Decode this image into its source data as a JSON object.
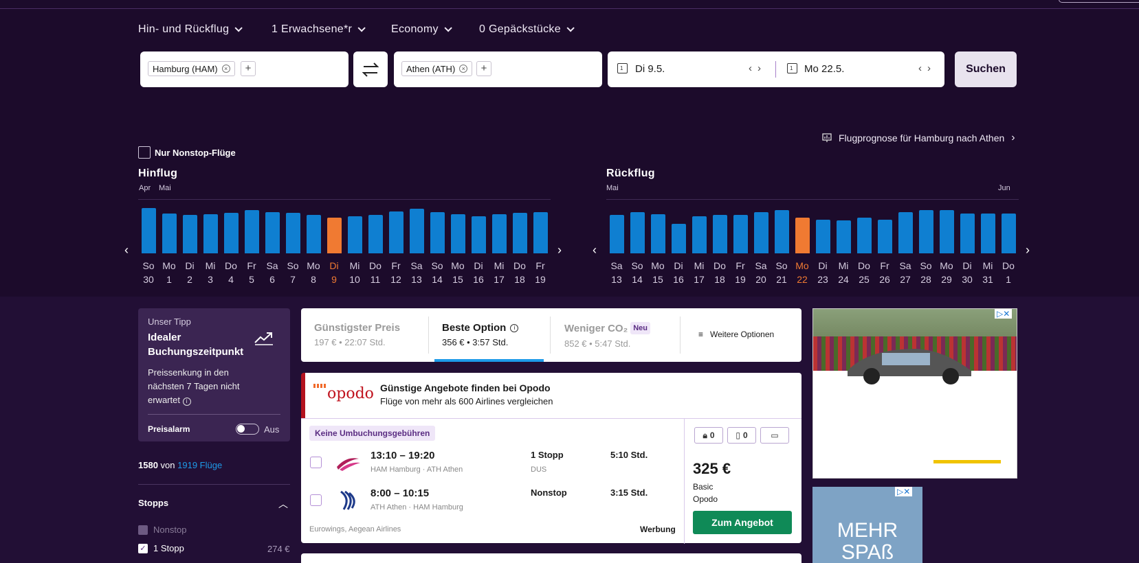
{
  "options": {
    "trip_type": "Hin- und Rückflug",
    "passengers": "1 Erwachsene*r",
    "cabin": "Economy",
    "baggage": "0 Gepäckstücke"
  },
  "search": {
    "origin": "Hamburg (HAM)",
    "destination": "Athen (ATH)",
    "depart_date": "Di 9.5.",
    "return_date": "Mo 22.5.",
    "search_label": "Suchen"
  },
  "forecast_link": "Flugprognose für Hamburg nach Athen",
  "nonstop_filter": "Nur Nonstop-Flüge",
  "outbound": {
    "title": "Hinflug",
    "months": [
      "Apr",
      "Mai"
    ],
    "days": [
      {
        "wd": "So",
        "d": "30",
        "level": 0.97
      },
      {
        "wd": "Mo",
        "d": "1",
        "level": 0.85
      },
      {
        "wd": "Di",
        "d": "2",
        "level": 0.82
      },
      {
        "wd": "Mi",
        "d": "3",
        "level": 0.84
      },
      {
        "wd": "Do",
        "d": "4",
        "level": 0.87
      },
      {
        "wd": "Fr",
        "d": "5",
        "level": 0.92
      },
      {
        "wd": "Sa",
        "d": "6",
        "level": 0.88
      },
      {
        "wd": "So",
        "d": "7",
        "level": 0.87
      },
      {
        "wd": "Mo",
        "d": "8",
        "level": 0.82
      },
      {
        "wd": "Di",
        "d": "9",
        "level": 0.77,
        "selected": true
      },
      {
        "wd": "Mi",
        "d": "10",
        "level": 0.8
      },
      {
        "wd": "Do",
        "d": "11",
        "level": 0.82
      },
      {
        "wd": "Fr",
        "d": "12",
        "level": 0.89
      },
      {
        "wd": "Sa",
        "d": "13",
        "level": 0.95
      },
      {
        "wd": "So",
        "d": "14",
        "level": 0.88
      },
      {
        "wd": "Mo",
        "d": "15",
        "level": 0.84
      },
      {
        "wd": "Di",
        "d": "16",
        "level": 0.8
      },
      {
        "wd": "Mi",
        "d": "17",
        "level": 0.84
      },
      {
        "wd": "Do",
        "d": "18",
        "level": 0.87
      },
      {
        "wd": "Fr",
        "d": "19",
        "level": 0.88
      }
    ]
  },
  "return": {
    "title": "Rückflug",
    "months": [
      "Mai",
      "Jun"
    ],
    "days": [
      {
        "wd": "Sa",
        "d": "13",
        "level": 0.82
      },
      {
        "wd": "So",
        "d": "14",
        "level": 0.88
      },
      {
        "wd": "Mo",
        "d": "15",
        "level": 0.84
      },
      {
        "wd": "Di",
        "d": "16",
        "level": 0.63
      },
      {
        "wd": "Mi",
        "d": "17",
        "level": 0.8
      },
      {
        "wd": "Do",
        "d": "18",
        "level": 0.82
      },
      {
        "wd": "Fr",
        "d": "19",
        "level": 0.83
      },
      {
        "wd": "Sa",
        "d": "20",
        "level": 0.88
      },
      {
        "wd": "So",
        "d": "21",
        "level": 0.92
      },
      {
        "wd": "Mo",
        "d": "22",
        "level": 0.77,
        "selected": true
      },
      {
        "wd": "Di",
        "d": "23",
        "level": 0.72
      },
      {
        "wd": "Mi",
        "d": "24",
        "level": 0.7
      },
      {
        "wd": "Do",
        "d": "25",
        "level": 0.77
      },
      {
        "wd": "Fr",
        "d": "26",
        "level": 0.72
      },
      {
        "wd": "Sa",
        "d": "27",
        "level": 0.88
      },
      {
        "wd": "So",
        "d": "28",
        "level": 0.92
      },
      {
        "wd": "Mo",
        "d": "29",
        "level": 0.92
      },
      {
        "wd": "Di",
        "d": "30",
        "level": 0.85
      },
      {
        "wd": "Mi",
        "d": "31",
        "level": 0.85
      },
      {
        "wd": "Do",
        "d": "1",
        "level": 0.85
      }
    ]
  },
  "tip": {
    "kicker": "Unser Tipp",
    "title": "Idealer Buchungszeitpunkt",
    "text": "Preissenkung in den nächsten 7 Tagen nicht erwartet",
    "alarm_label": "Preisalarm",
    "alarm_state": "Aus"
  },
  "results_count": {
    "shown": "1580",
    "of": "von",
    "total": "1919 Flüge"
  },
  "filters": {
    "stops_title": "Stopps",
    "items": [
      {
        "label": "Nonstop",
        "price": "",
        "checked": false
      },
      {
        "label": "1 Stopp",
        "price": "274 €",
        "checked": true
      }
    ]
  },
  "sort_tabs": [
    {
      "title": "Günstigster Preis",
      "sub": "197 € • 22:07 Std."
    },
    {
      "title": "Beste Option",
      "sub": "356 € • 3:57 Std."
    },
    {
      "title": "Weniger CO₂",
      "badge": "Neu",
      "sub": "852 € • 5:47 Std."
    }
  ],
  "more_options": "Weitere Optionen",
  "opodo_ad": {
    "logo": "opodo",
    "headline": "Günstige Angebote finden bei Opodo",
    "sub": "Flüge von mehr als 600 Airlines vergleichen"
  },
  "result": {
    "badge": "Keine Umbuchungsgebühren",
    "legs": [
      {
        "time": "13:10 – 19:20",
        "route": "HAM Hamburg · ATH Athen",
        "stops": "1 Stopp",
        "via": "DUS",
        "duration": "5:10 Std."
      },
      {
        "time": "8:00 – 10:15",
        "route": "ATH Athen · HAM Hamburg",
        "stops": "Nonstop",
        "via": "",
        "duration": "3:15 Std."
      }
    ],
    "airlines": "Eurowings, Aegean Airlines",
    "ad_label": "Werbung",
    "bag_count_1": "0",
    "bag_count_2": "0",
    "price": "325 €",
    "fare": "Basic",
    "provider": "Opodo",
    "cta": "Zum Angebot"
  },
  "ad_banner_text": "MEHR SPAß"
}
